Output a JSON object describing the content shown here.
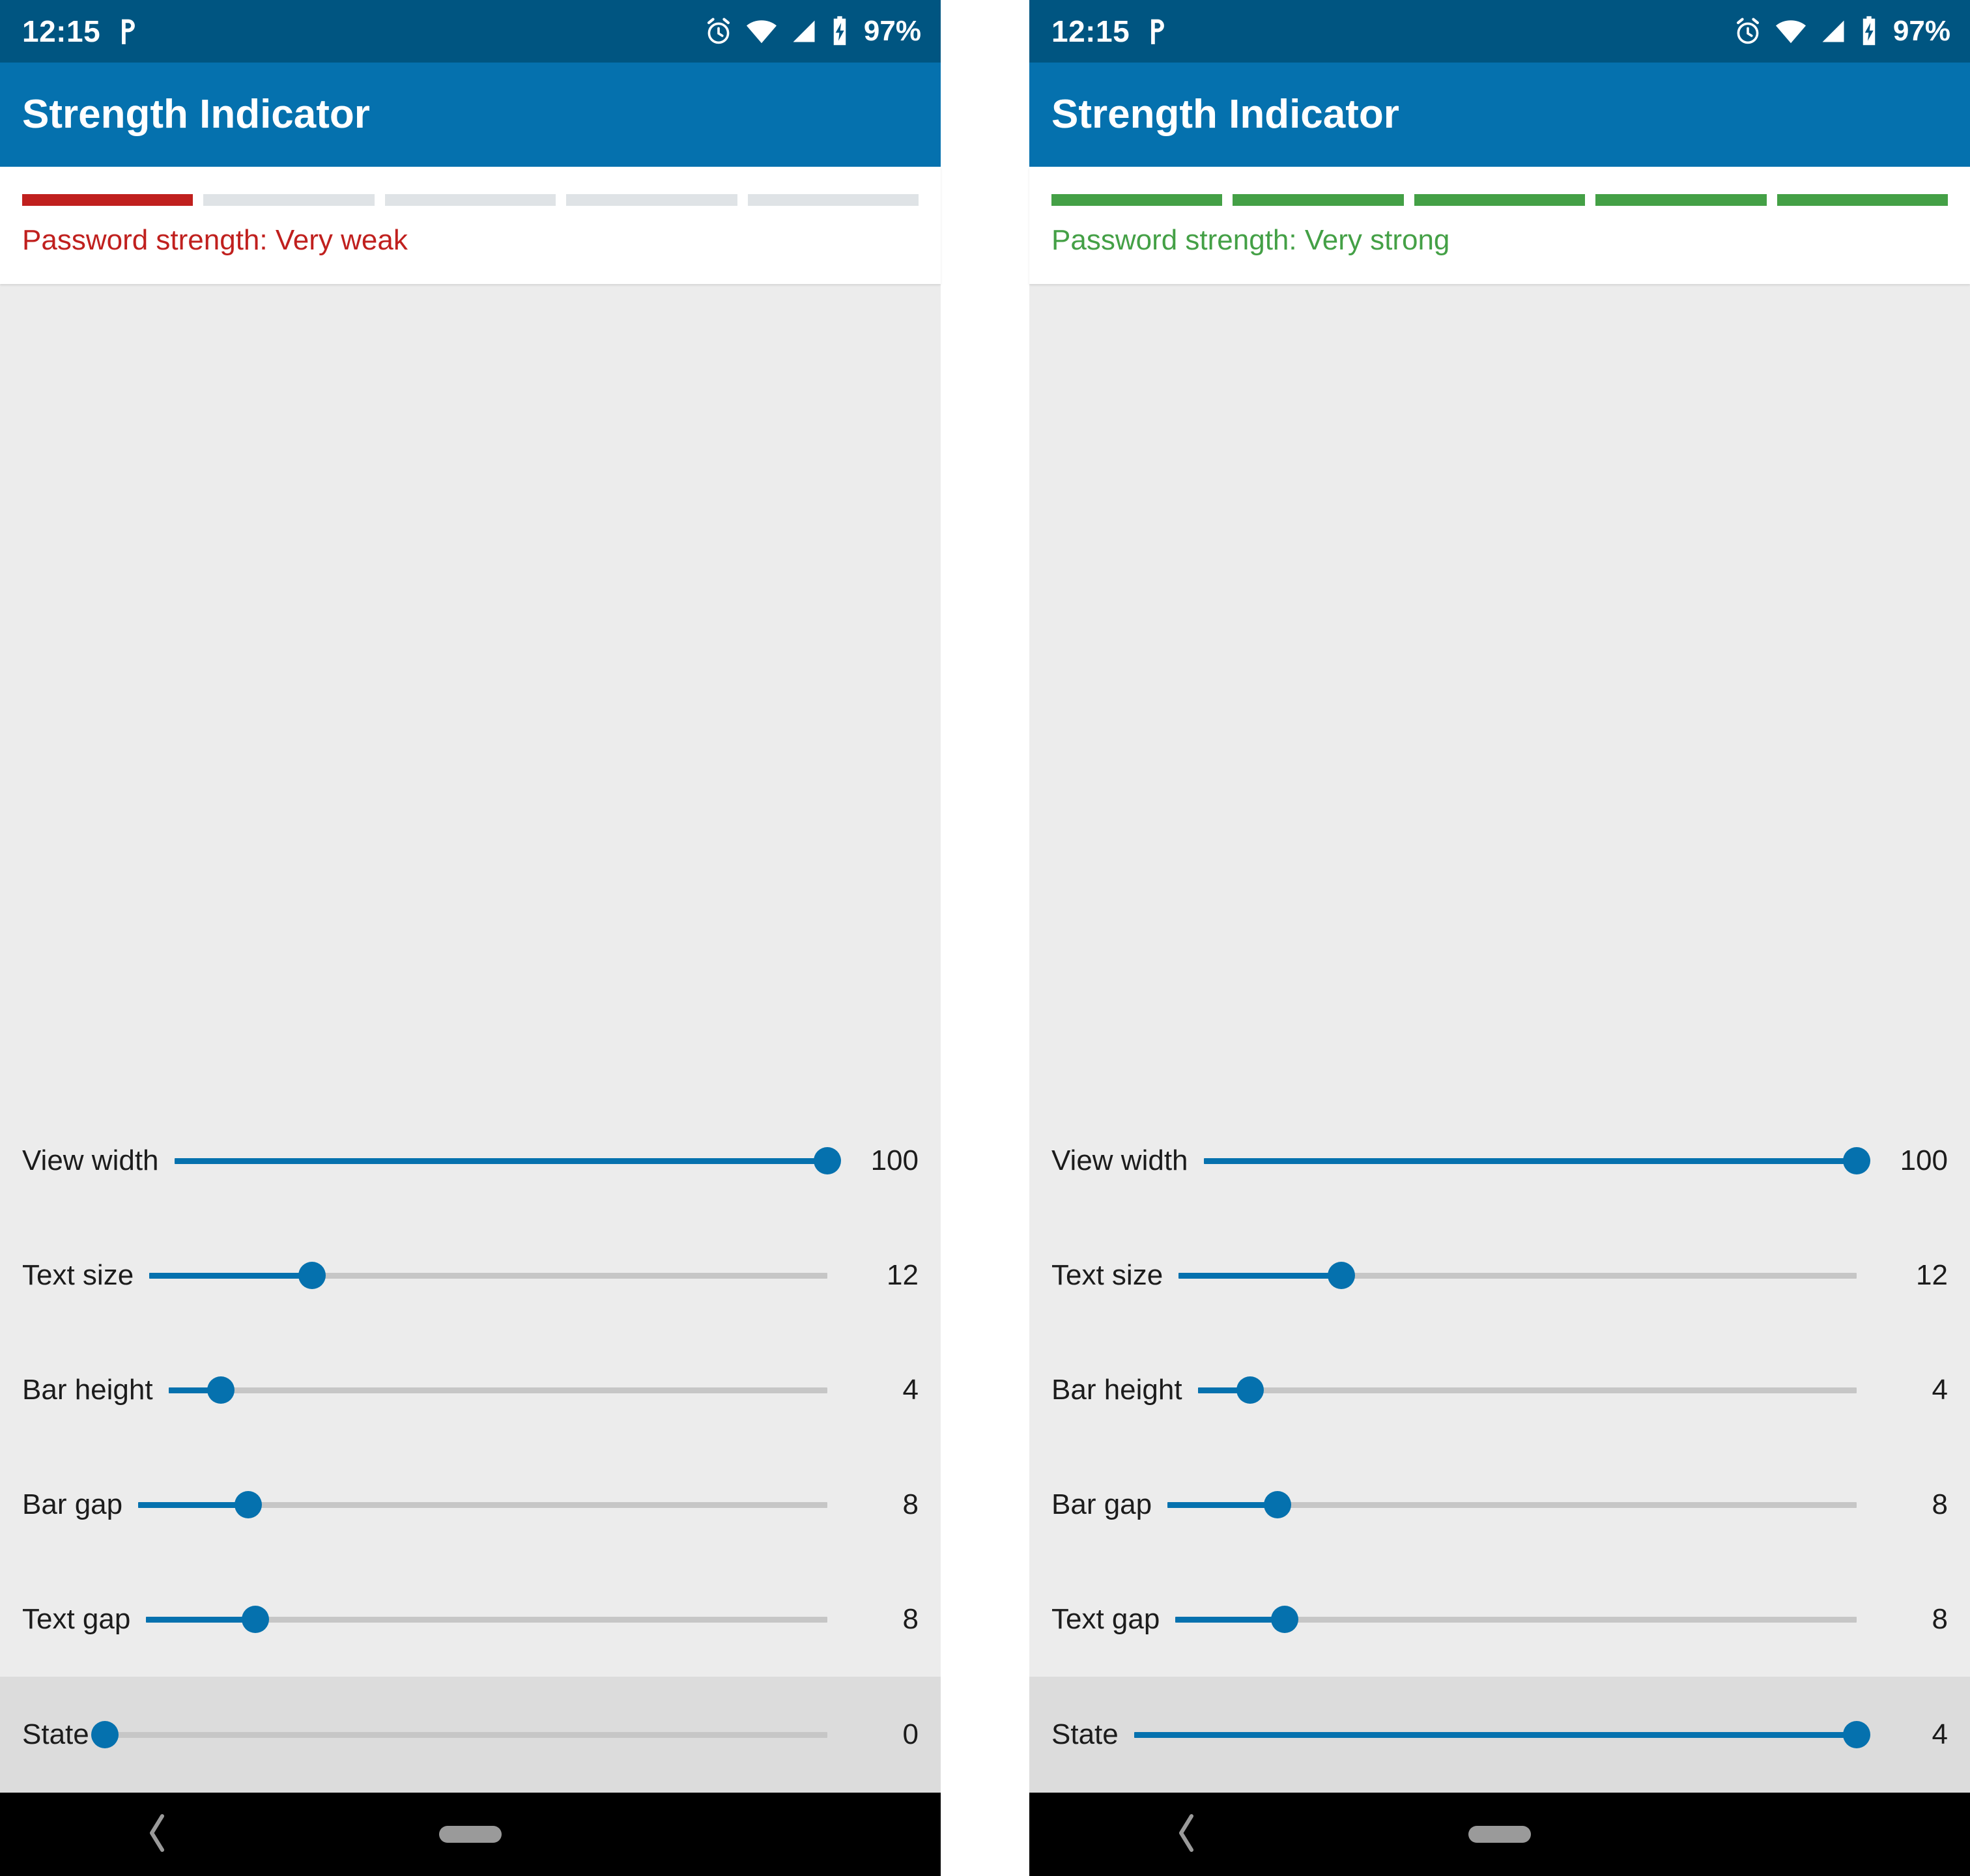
{
  "screens": [
    {
      "id": "left",
      "status_bar": {
        "time": "12:15",
        "icons": [
          "p-icon",
          "alarm-icon",
          "wifi-icon",
          "cellular-icon",
          "battery-charging-icon"
        ],
        "battery": "97%"
      },
      "app_bar": {
        "title": "Strength Indicator"
      },
      "strength": {
        "label": "Password strength: Very weak",
        "color": "#C0201E",
        "total_bars": 5,
        "filled_bars": 1,
        "state": "weak"
      },
      "sliders": [
        {
          "label": "View width",
          "value": "100",
          "percent": 100
        },
        {
          "label": "Text size",
          "value": "12",
          "percent": 24
        },
        {
          "label": "Bar height",
          "value": "4",
          "percent": 8
        },
        {
          "label": "Bar gap",
          "value": "8",
          "percent": 16
        },
        {
          "label": "Text gap",
          "value": "8",
          "percent": 16
        }
      ],
      "state_slider": {
        "label": "State",
        "value": "0",
        "percent": 0
      },
      "nav_bar": {
        "back": "back-chevron-icon",
        "home": "home-pill-icon"
      }
    },
    {
      "id": "right",
      "status_bar": {
        "time": "12:15",
        "icons": [
          "p-icon",
          "alarm-icon",
          "wifi-icon",
          "cellular-icon",
          "battery-charging-icon"
        ],
        "battery": "97%"
      },
      "app_bar": {
        "title": "Strength Indicator"
      },
      "strength": {
        "label": "Password strength: Very strong",
        "color": "#44A046",
        "total_bars": 5,
        "filled_bars": 5,
        "state": "strong"
      },
      "sliders": [
        {
          "label": "View width",
          "value": "100",
          "percent": 100
        },
        {
          "label": "Text size",
          "value": "12",
          "percent": 24
        },
        {
          "label": "Bar height",
          "value": "4",
          "percent": 8
        },
        {
          "label": "Bar gap",
          "value": "8",
          "percent": 16
        },
        {
          "label": "Text gap",
          "value": "8",
          "percent": 16
        }
      ],
      "state_slider": {
        "label": "State",
        "value": "4",
        "percent": 100
      },
      "nav_bar": {
        "back": "back-chevron-icon",
        "home": "home-pill-icon"
      }
    }
  ],
  "colors": {
    "status_bar": "#005581",
    "app_bar": "#0571AE",
    "accent": "#0571AE",
    "weak": "#C0201E",
    "strong": "#44A046",
    "track_inactive": "#c6c6c6",
    "bar_inactive": "#dfe3e6",
    "settings_bg": "#ececec",
    "state_row_bg": "#dcdcdc"
  }
}
